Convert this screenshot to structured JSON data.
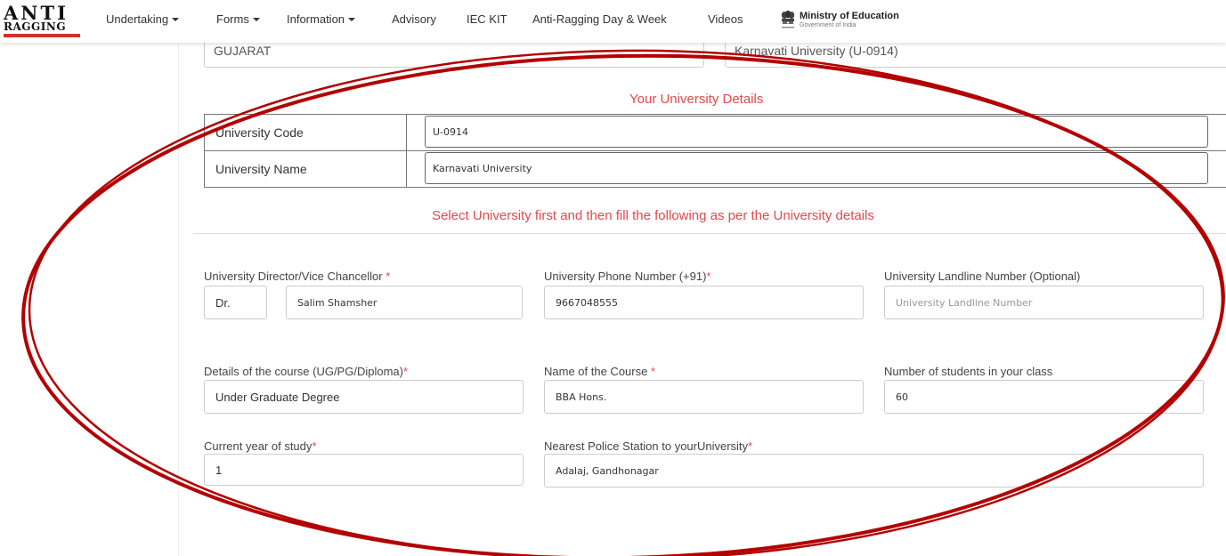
{
  "logo": {
    "line1": "ANTI",
    "line2": "RAGGING"
  },
  "nav": {
    "undertaking": "Undertaking",
    "forms": "Forms",
    "information": "Information",
    "advisory": "Advisory",
    "iec_kit": "IEC KIT",
    "ragging_day": "Anti-Ragging Day & Week",
    "videos": "Videos"
  },
  "ministry": {
    "title": "Ministry of Education",
    "subtitle": "Government of India"
  },
  "top_fields": {
    "state": "GUJARAT",
    "university": "Karnavati University (U-0914)"
  },
  "university_details": {
    "title": "Your University Details",
    "code_label": "University Code",
    "code_value": "U-0914",
    "name_label": "University Name",
    "name_value": "Karnavati University"
  },
  "instruction": "Select University first and then fill the following as per the University details",
  "form": {
    "director_label": "University Director/Vice Chancellor ",
    "director_prefix": "Dr.",
    "director_name": "Salim Shamsher",
    "phone_label": "University Phone Number (+91)",
    "phone_value": "9667048555",
    "landline_label": "University Landline Number (Optional)",
    "landline_placeholder": "University Landline Number",
    "course_details_label": "Details of the course (UG/PG/Diploma)",
    "course_details_value": "Under Graduate Degree",
    "course_name_label": "Name of the Course ",
    "course_name_value": "BBA Hons.",
    "students_label": "Number of students in your class",
    "students_value": "60",
    "year_label": "Current year of study",
    "year_value": "1",
    "police_label": "Nearest Police Station to yourUniversity",
    "police_value": "Adalaj, Gandhonagar",
    "required_mark": "*"
  },
  "colors": {
    "accent": "#e5484d",
    "annotation": "#b30000"
  }
}
